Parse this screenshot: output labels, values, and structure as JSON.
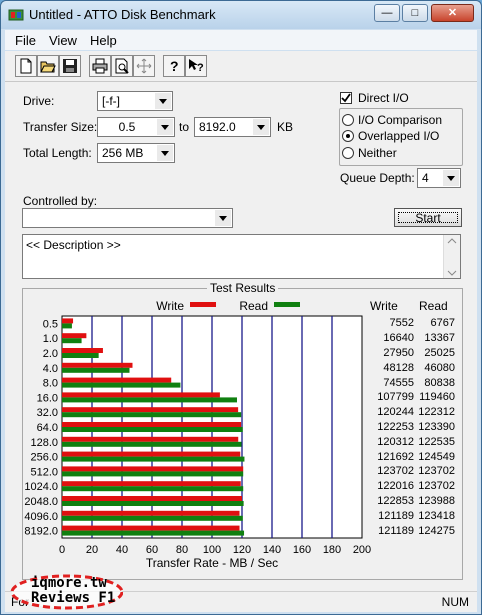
{
  "window": {
    "title": "Untitled - ATTO Disk Benchmark"
  },
  "menu": [
    "File",
    "View",
    "Help"
  ],
  "toolbar": [
    "new-icon",
    "open-icon",
    "save-icon",
    "print-icon",
    "print-preview-icon",
    "move-icon",
    "help-icon",
    "context-help-icon"
  ],
  "form": {
    "drive_label": "Drive:",
    "drive_value": "[-f-]",
    "transfer_size_label": "Transfer Size:",
    "transfer_from": "0.5",
    "to_label": "to",
    "transfer_to": "8192.0",
    "kb_label": "KB",
    "total_length_label": "Total Length:",
    "total_length_value": "256 MB",
    "direct_io_label": "Direct I/O",
    "io_comparison_label": "I/O Comparison",
    "overlapped_io_label": "Overlapped I/O",
    "neither_label": "Neither",
    "queue_depth_label": "Queue Depth:",
    "queue_depth_value": "4",
    "controlled_by_label": "Controlled by:",
    "controlled_by_value": "",
    "start_label": "Start",
    "description_text": "<< Description >>"
  },
  "results": {
    "title": "Test Results",
    "legend_write": "Write",
    "legend_read": "Read",
    "col_write": "Write",
    "col_read": "Read"
  },
  "chart_data": {
    "type": "bar",
    "orientation": "horizontal",
    "categories": [
      "0.5",
      "1.0",
      "2.0",
      "4.0",
      "8.0",
      "16.0",
      "32.0",
      "64.0",
      "128.0",
      "256.0",
      "512.0",
      "1024.0",
      "2048.0",
      "4096.0",
      "8192.0"
    ],
    "series": [
      {
        "name": "Write",
        "color": "#e01010",
        "values": [
          7552,
          16640,
          27950,
          48128,
          74555,
          107799,
          120244,
          122253,
          120312,
          121692,
          123702,
          122016,
          122853,
          121189,
          121189
        ]
      },
      {
        "name": "Read",
        "color": "#108010",
        "values": [
          6767,
          13367,
          25025,
          46080,
          80838,
          119460,
          122312,
          123390,
          122535,
          124549,
          123702,
          123702,
          123988,
          123418,
          124275
        ]
      }
    ],
    "xlabel": "Transfer Rate - MB / Sec",
    "xticks": [
      0,
      20,
      40,
      60,
      80,
      100,
      120,
      140,
      160,
      180,
      200
    ],
    "xlim": [
      0,
      200
    ],
    "units_note_kb": true,
    "grid": true,
    "legend": "top"
  },
  "watermark": {
    "line1": "iqmore.tw",
    "line2": "Reviews F1"
  },
  "status": {
    "text": "For",
    "key": "NUM"
  }
}
